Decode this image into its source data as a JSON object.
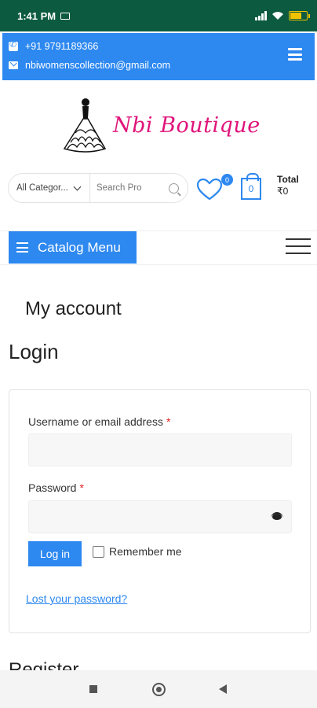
{
  "status_bar": {
    "time": "1:41 PM",
    "battery_level": 0.7,
    "icons": [
      "laptop-icon",
      "signal-icon",
      "wifi-icon",
      "battery-icon"
    ]
  },
  "topbar": {
    "phone": "+91 9791189366",
    "email": "nbiwomenscollection@gmail.com",
    "bg_color": "#2d88f0"
  },
  "logo": {
    "brand": "Nbi Boutique",
    "color": "#e0147a"
  },
  "search": {
    "category_label": "All Categor...",
    "placeholder": "Search Pro"
  },
  "wishlist": {
    "count": "0"
  },
  "cart": {
    "count": "0",
    "total_label": "Total",
    "total_value": "₹0"
  },
  "catalog": {
    "label": "Catalog Menu"
  },
  "page": {
    "title": "My account",
    "login_heading": "Login",
    "register_heading": "Register"
  },
  "login_form": {
    "username_label": "Username or email address",
    "password_label": "Password",
    "required_mark": "*",
    "username_value": "",
    "password_value": "",
    "login_button": "Log in",
    "remember_label": "Remember me",
    "remember_checked": false,
    "lost_password_link": "Lost your password?"
  },
  "nav": {
    "buttons": [
      "recents-icon",
      "home-icon",
      "back-icon"
    ]
  }
}
